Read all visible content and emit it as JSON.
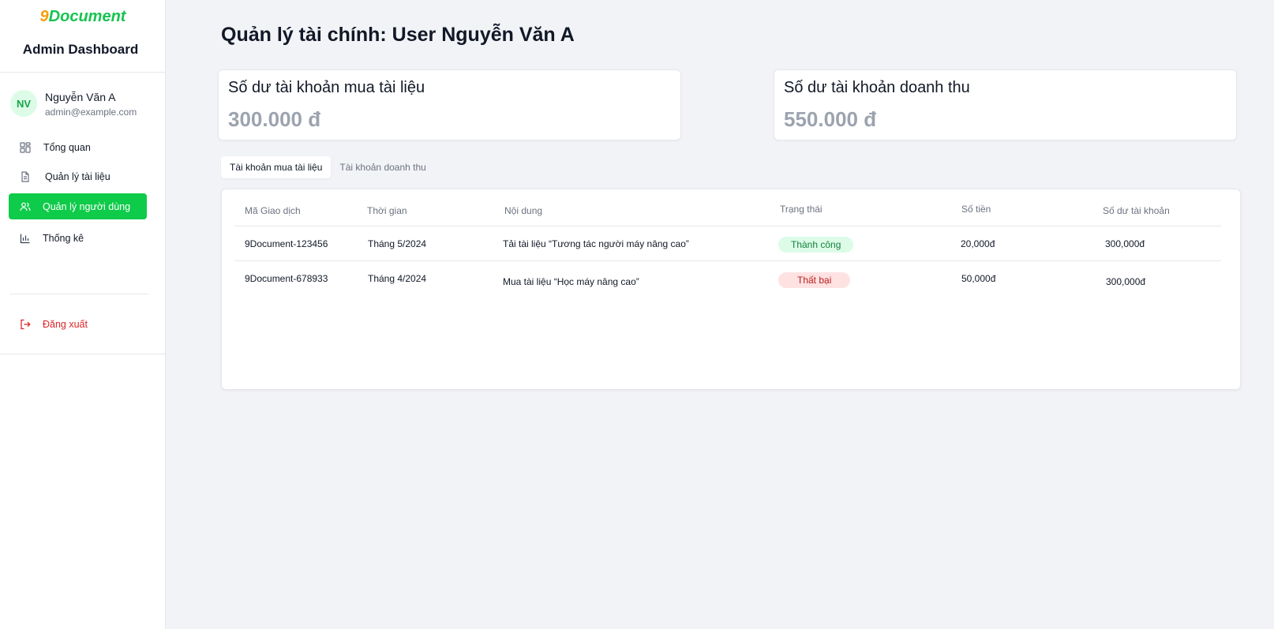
{
  "brand": {
    "logo_prefix": "9",
    "logo_suffix": "Document",
    "app_title": "Admin Dashboard"
  },
  "user": {
    "initials": "NV",
    "name": "Nguyễn Văn A",
    "email": "admin@example.com"
  },
  "sidebar": {
    "items": [
      {
        "label": "Tổng quan",
        "icon": "grid-icon",
        "active": false
      },
      {
        "label": "Quản lý tài liệu",
        "icon": "document-icon",
        "active": false
      },
      {
        "label": "Quản lý người dùng",
        "icon": "users-icon",
        "active": true
      },
      {
        "label": "Thống kê",
        "icon": "bar-chart-icon",
        "active": false
      }
    ],
    "logout_label": "Đăng xuất",
    "logout_icon": "logout-icon"
  },
  "page": {
    "title": "Quản lý tài chính: User Nguyễn Văn A"
  },
  "cards": [
    {
      "title": "Số dư tài khoản mua tài liệu",
      "value": "300.000 đ"
    },
    {
      "title": "Số dư tài khoản doanh thu",
      "value": "550.000 đ"
    }
  ],
  "tabs": [
    {
      "label": "Tài khoản mua tài liệu",
      "active": true
    },
    {
      "label": "Tài khoản doanh thu",
      "active": false
    }
  ],
  "table": {
    "headers": [
      "Mã Giao dịch",
      "Thời gian",
      "Nội dung",
      "Trạng thái",
      "Số tiền",
      "Số dư tài khoản"
    ],
    "rows": [
      {
        "id": "9Document-123456",
        "time": "Tháng 5/2024",
        "content": "Tải tài liệu “Tương tác người máy nâng cao”",
        "status": "Thành công",
        "status_type": "success",
        "amount": "20,000đ",
        "balance": "300,000đ"
      },
      {
        "id": "9Document-678933",
        "time": "Tháng 4/2024",
        "content": "Mua tài liệu “Học máy nâng cao”",
        "status": "Thất bại",
        "status_type": "failed",
        "amount": "50,000đ",
        "balance": "300,000đ"
      }
    ]
  },
  "colors": {
    "accent": "#0ecb4a",
    "logo_orange": "#f59e0b",
    "logo_green": "#16c44f",
    "danger": "#dc2626",
    "success_bg": "#dcfce7",
    "failed_bg": "#fee2e2"
  }
}
